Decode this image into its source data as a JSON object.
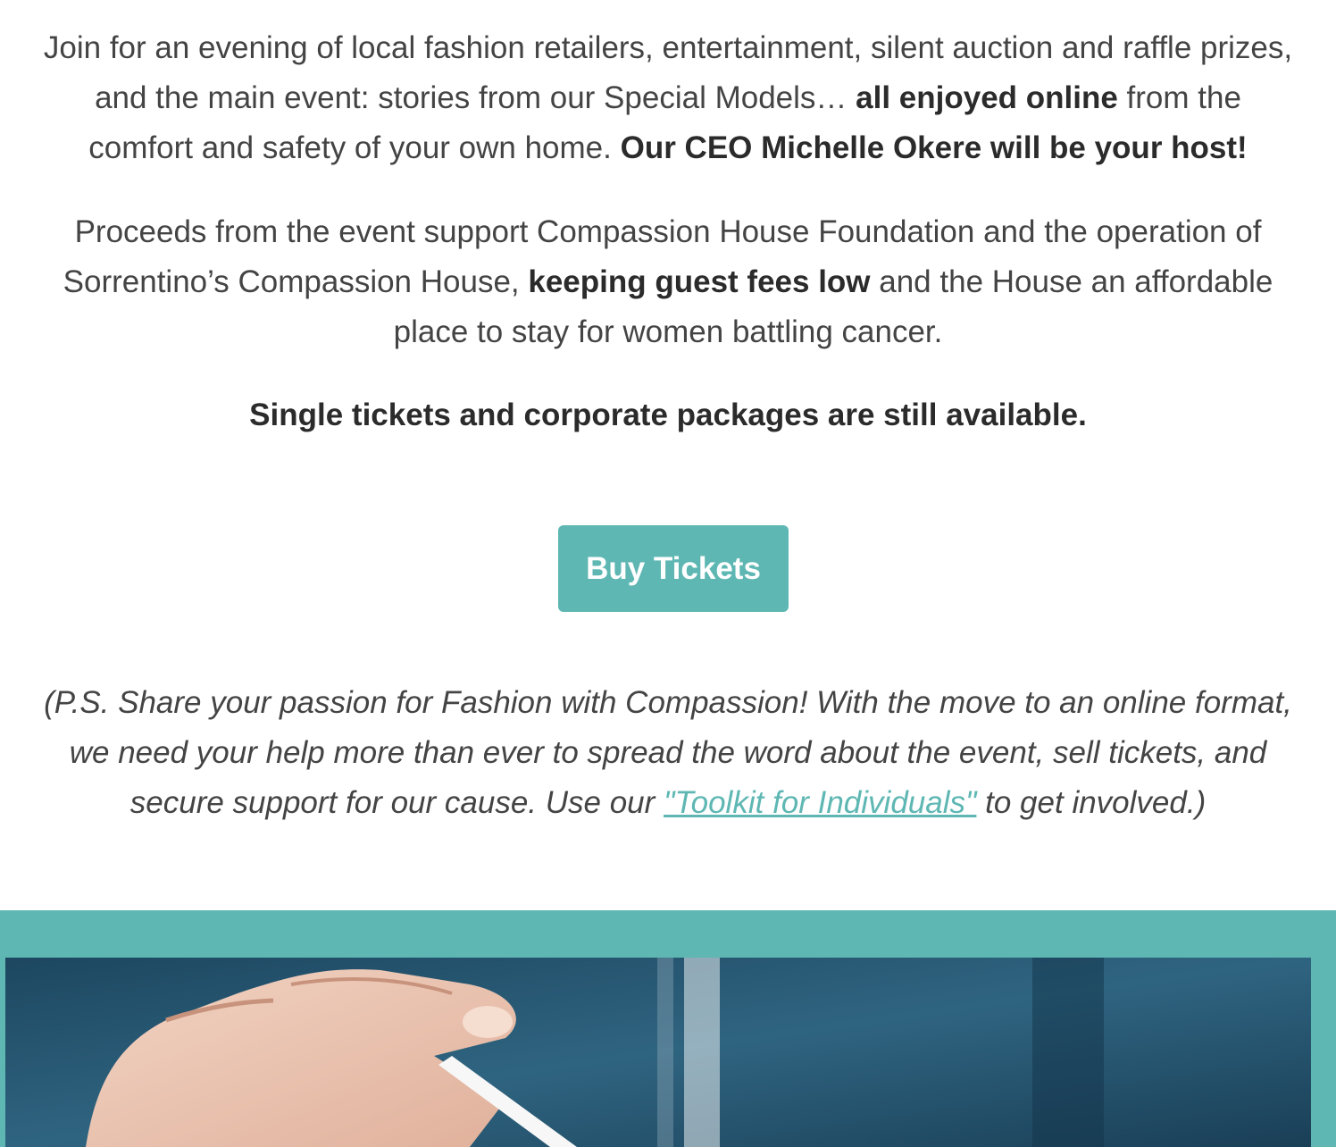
{
  "intro": {
    "line1": "Join for an evening of local fashion retailers, entertainment, silent auction and raffle prizes,",
    "line2_pre": "and the main event: stories from our Special Models… ",
    "line2_bold": "all enjoyed online",
    "line2_post": " from the",
    "line3_pre": "comfort and safety of your own home. ",
    "line3_bold": "Our CEO Michelle Okere will be your host!"
  },
  "proceeds": {
    "line1": "Proceeds from the event support Compassion House Foundation and the operation of",
    "line2_pre": "Sorrentino’s Compassion House, ",
    "line2_bold": "keeping guest fees low",
    "line2_post": " and the House an affordable",
    "line3": "place to stay for women battling cancer."
  },
  "availability": "Single tickets and corporate packages are still available.",
  "cta": {
    "label": "Buy Tickets",
    "color": "#5eb7b3"
  },
  "ps": {
    "line1": "(P.S. Share your passion for Fashion with Compassion! With the move to an online format,",
    "line2": "we need your help more than ever to spread the word about the event, sell tickets, and",
    "line3_pre": "secure support for our cause. Use our ",
    "link_text": "\"Toolkit for Individuals\"",
    "line3_post": " to get involved.)"
  },
  "colors": {
    "accent": "#5eb7b3",
    "text": "#444444"
  }
}
